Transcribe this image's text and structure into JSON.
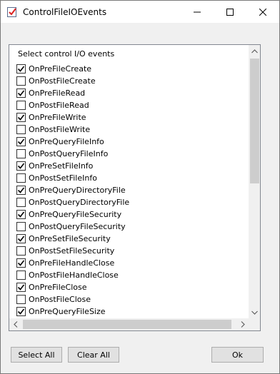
{
  "window": {
    "title": "ControlFileIOEvents"
  },
  "list": {
    "header": "Select control I/O events",
    "items": [
      {
        "label": "OnPreFileCreate",
        "checked": true
      },
      {
        "label": "OnPostFileCreate",
        "checked": false
      },
      {
        "label": "OnPreFileRead",
        "checked": true
      },
      {
        "label": "OnPostFileRead",
        "checked": false
      },
      {
        "label": "OnPreFileWrite",
        "checked": true
      },
      {
        "label": "OnPostFileWrite",
        "checked": false
      },
      {
        "label": "OnPreQueryFileInfo",
        "checked": true
      },
      {
        "label": "OnPostQueryFileInfo",
        "checked": false
      },
      {
        "label": "OnPreSetFileInfo",
        "checked": true
      },
      {
        "label": "OnPostSetFileInfo",
        "checked": false
      },
      {
        "label": "OnPreQueryDirectoryFile",
        "checked": true
      },
      {
        "label": "OnPostQueryDirectoryFile",
        "checked": false
      },
      {
        "label": "OnPreQueryFileSecurity",
        "checked": true
      },
      {
        "label": "OnPostQueryFileSecurity",
        "checked": false
      },
      {
        "label": "OnPreSetFileSecurity",
        "checked": true
      },
      {
        "label": "OnPostSetFileSecurity",
        "checked": false
      },
      {
        "label": "OnPreFileHandleClose",
        "checked": true
      },
      {
        "label": "OnPostFileHandleClose",
        "checked": false
      },
      {
        "label": "OnPreFileClose",
        "checked": true
      },
      {
        "label": "OnPostFileClose",
        "checked": false
      },
      {
        "label": "OnPreQueryFileSize",
        "checked": true
      }
    ]
  },
  "buttons": {
    "select_all": "Select All",
    "clear_all": "Clear All",
    "ok": "Ok"
  },
  "colors": {
    "titlebar": "#ffffff",
    "window_bg": "#f0f0f0",
    "button_bg": "#e1e1e1",
    "check": "#000000"
  },
  "icons": {
    "app": "app-checkbox-icon",
    "minimize": "minimize-icon",
    "maximize": "maximize-icon",
    "close": "close-icon"
  }
}
